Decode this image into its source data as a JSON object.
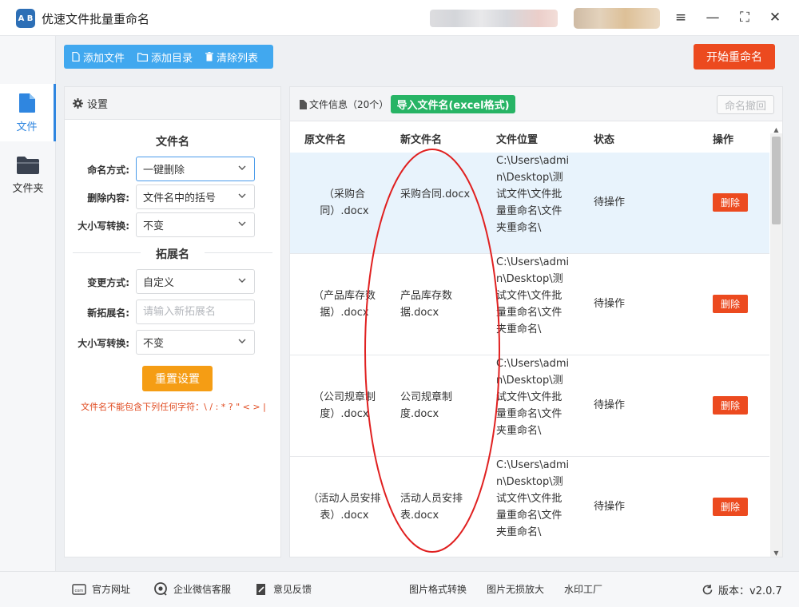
{
  "app": {
    "title": "优速文件批量重命名",
    "logo_text": "A B"
  },
  "window_controls": {
    "menu": "≡",
    "minimize": "—",
    "maximize": "⛶",
    "close": "✕"
  },
  "nav": [
    {
      "label": "文件",
      "icon": "file-icon",
      "active": true
    },
    {
      "label": "文件夹",
      "icon": "folder-icon",
      "active": false
    }
  ],
  "toolbar": {
    "add_file": "添加文件",
    "add_dir": "添加目录",
    "clear_list": "清除列表",
    "start": "开始重命名"
  },
  "settings": {
    "header": "设置",
    "filename_section": "文件名",
    "naming_mode_label": "命名方式:",
    "naming_mode_value": "一键删除",
    "delete_content_label": "删除内容:",
    "delete_content_value": "文件名中的括号",
    "case_label": "大小写转换:",
    "case_value": "不变",
    "ext_section": "拓展名",
    "change_mode_label": "变更方式:",
    "change_mode_value": "自定义",
    "new_ext_label": "新拓展名:",
    "new_ext_placeholder": "请输入新拓展名",
    "ext_case_label": "大小写转换:",
    "ext_case_value": "不变",
    "reset": "重置设置",
    "warning": "文件名不能包含下列任何字符：\\ / : * ? \" < > |"
  },
  "files": {
    "info_label": "文件信息（20个）",
    "import_btn": "导入文件名(excel格式)",
    "undo_btn": "命名撤回",
    "columns": {
      "original": "原文件名",
      "new": "新文件名",
      "location": "文件位置",
      "status": "状态",
      "action": "操作"
    },
    "rows": [
      {
        "original": "（采购合同）.docx",
        "new": "采购合同.docx",
        "location": "C:\\Users\\admin\\Desktop\\测试文件\\文件批量重命名\\文件夹重命名\\",
        "status": "待操作",
        "action": "删除"
      },
      {
        "original": "（产品库存数据）.docx",
        "new": "产品库存数据.docx",
        "location": "C:\\Users\\admin\\Desktop\\测试文件\\文件批量重命名\\文件夹重命名\\",
        "status": "待操作",
        "action": "删除"
      },
      {
        "original": "（公司规章制度）.docx",
        "new": "公司规章制度.docx",
        "location": "C:\\Users\\admin\\Desktop\\测试文件\\文件批量重命名\\文件夹重命名\\",
        "status": "待操作",
        "action": "删除"
      },
      {
        "original": "（活动人员安排表）.docx",
        "new": "活动人员安排表.docx",
        "location": "C:\\Users\\admin\\Desktop\\测试文件\\文件批量重命名\\文件夹重命名\\",
        "status": "待操作",
        "action": "删除"
      }
    ]
  },
  "statusbar": {
    "website": "官方网址",
    "wechat": "企业微信客服",
    "feedback": "意见反馈",
    "img_convert": "图片格式转换",
    "img_enlarge": "图片无损放大",
    "watermark": "水印工厂",
    "version": "版本：v2.0.7"
  },
  "colors": {
    "accent_blue": "#41a8ef",
    "start_red": "#ec4a1f",
    "reset_orange": "#f59d14",
    "import_green": "#27b465",
    "annotation_red": "#e02020"
  }
}
